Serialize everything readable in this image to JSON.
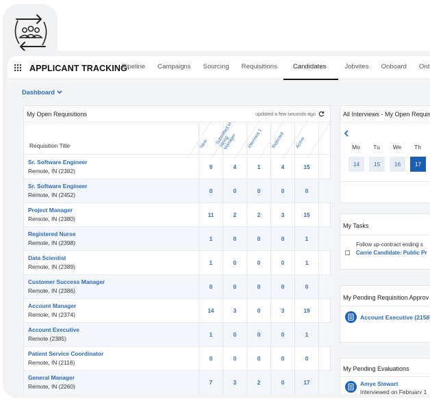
{
  "brand": "APPLICANT TRACKING",
  "tabs": [
    {
      "label": "Pipeline"
    },
    {
      "label": "Campaigns"
    },
    {
      "label": "Sourcing"
    },
    {
      "label": "Requisitions"
    },
    {
      "label": "Candidates",
      "active": true
    },
    {
      "label": "Jobvites"
    },
    {
      "label": "Onboard"
    },
    {
      "label": "Onb"
    }
  ],
  "dashboard_label": "Dashboard",
  "requisitions": {
    "title": "My Open Requisitions",
    "updated": "updated a few seconds ago",
    "title_column": "Requisition Title",
    "columns": [
      "New",
      "Submitted to Hiring Manager",
      "Interview 1",
      "Rejected",
      "Active"
    ],
    "rows": [
      {
        "title": "Sr. Software Engineer",
        "location": "Remote, IN (2382)",
        "values": [
          "9",
          "4",
          "1",
          "4",
          "15"
        ]
      },
      {
        "title": "Sr. Software Engineer",
        "location": "Remote, IN (2452)",
        "values": [
          "0",
          "0",
          "0",
          "0",
          "0"
        ]
      },
      {
        "title": "Project Manager",
        "location": "Remote, IN (2380)",
        "values": [
          "11",
          "2",
          "2",
          "3",
          "15"
        ]
      },
      {
        "title": "Registered Nurse",
        "location": "Remote, IN (2398)",
        "values": [
          "1",
          "0",
          "0",
          "0",
          "1"
        ]
      },
      {
        "title": "Data Scientist",
        "location": "Remote, IN (2389)",
        "values": [
          "1",
          "0",
          "0",
          "0",
          "1"
        ]
      },
      {
        "title": "Customer Success Manager",
        "location": "Remote, IN (2386)",
        "values": [
          "0",
          "0",
          "0",
          "0",
          "0"
        ]
      },
      {
        "title": "Account Manager",
        "location": "Remote, IN (2374)",
        "values": [
          "14",
          "3",
          "0",
          "3",
          "19"
        ]
      },
      {
        "title": "Account Executive",
        "location": "Remote (2385)",
        "values": [
          "1",
          "0",
          "0",
          "0",
          "1"
        ]
      },
      {
        "title": "Patient Service Coordinator",
        "location": "Remote, IN (2116)",
        "values": [
          "0",
          "0",
          "0",
          "0",
          "0"
        ]
      },
      {
        "title": "General Manager",
        "location": "Remote, IN (2260)",
        "values": [
          "7",
          "3",
          "2",
          "0",
          "17"
        ]
      }
    ]
  },
  "interviews": {
    "title": "All Interviews - My Open Requis",
    "days": [
      "Mo",
      "Tu",
      "We",
      "Th"
    ],
    "dates": [
      "14",
      "15",
      "16",
      "17"
    ],
    "today_index": 3
  },
  "tasks": {
    "title": "My Tasks",
    "items": [
      {
        "text": "Follow up-contract ending s",
        "link": "Carrie Candidate: Public Pr"
      }
    ]
  },
  "approvals": {
    "title": "My Pending Requisition Approv",
    "items": [
      {
        "label": "Account Executive (2158)"
      }
    ]
  },
  "evaluations": {
    "title": "My Pending Evaluations",
    "items": [
      {
        "name": "Amye Stewart",
        "detail": "Interviewed on February 1"
      }
    ]
  },
  "colors": {
    "accent": "#2a6ab8",
    "today": "#1a5fb4",
    "frame": "#f1f2f4"
  },
  "icons": {
    "logo": "team-cycle-icon",
    "apps": "grid-icon",
    "refresh": "refresh-icon",
    "back": "chevron-left-icon",
    "requisition": "document-list-icon"
  }
}
